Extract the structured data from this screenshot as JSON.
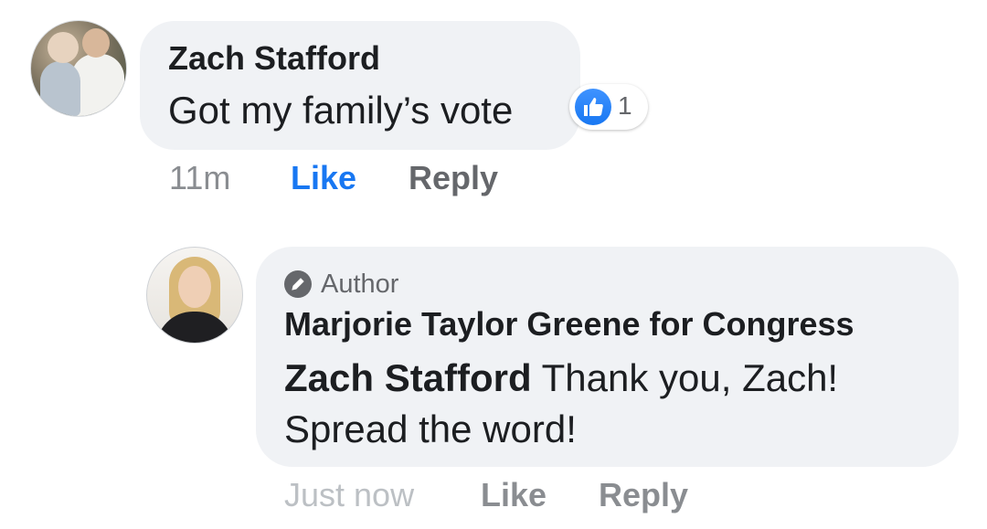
{
  "comment": {
    "author": "Zach Stafford",
    "text": "Got my family’s vote",
    "reactions": {
      "icon": "thumbs-up-icon",
      "count": "1",
      "color": "#1877f2"
    },
    "time": "11m",
    "like_label": "Like",
    "reply_label": "Reply",
    "liked": true
  },
  "reply": {
    "badge_icon": "pencil-icon",
    "badge_label": "Author",
    "author": "Marjorie Taylor Greene for Congress",
    "mention": "Zach Stafford",
    "text": "Thank you, Zach! Spread the word!",
    "time": "Just now",
    "like_label": "Like",
    "reply_label": "Reply"
  },
  "colors": {
    "bubble": "#f0f2f5",
    "text": "#1c1e21",
    "secondary": "#65676b",
    "link_active": "#1877f2"
  }
}
